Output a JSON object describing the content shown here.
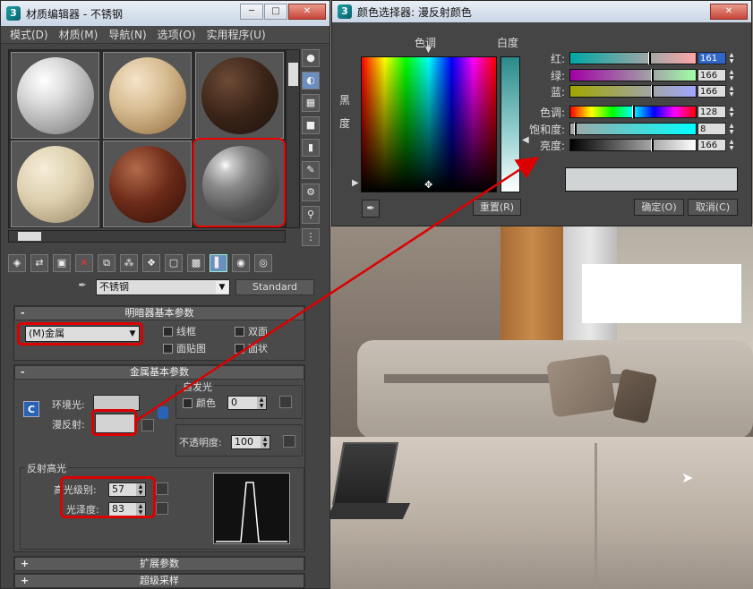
{
  "material_editor": {
    "title": "材质编辑器 - 不锈钢",
    "menu": [
      "模式(D)",
      "材质(M)",
      "导航(N)",
      "选项(O)",
      "实用程序(U)"
    ],
    "material_name": "不锈钢",
    "material_type": "Standard",
    "shader_rollout": {
      "title": "明暗器基本参数",
      "shader": "(M)金属",
      "wire": "线框",
      "two_sided": "双面",
      "face_map": "面贴图",
      "faceted": "面状"
    },
    "metal_rollout": {
      "title": "金属基本参数",
      "ambient_label": "环境光:",
      "diffuse_label": "漫反射:",
      "self_illum_title": "自发光",
      "color_label": "颜色",
      "color_value": "0",
      "opacity_label": "不透明度:",
      "opacity_value": "100",
      "specular_title": "反射高光",
      "spec_level_label": "高光级别:",
      "spec_level_value": "57",
      "gloss_label": "光泽度:",
      "gloss_value": "83",
      "lock_icon_letter": "C"
    },
    "collapsed_rollouts": [
      "扩展参数",
      "超级采样"
    ]
  },
  "color_selector": {
    "title": "颜色选择器: 漫反射颜色",
    "hue_label": "色调",
    "whiteness_label": "白度",
    "blackness_label_1": "黑",
    "blackness_label_2": "度",
    "channels": [
      {
        "label": "红:",
        "value": "161",
        "fraction": 0.63
      },
      {
        "label": "绿:",
        "value": "166",
        "fraction": 0.65
      },
      {
        "label": "蓝:",
        "value": "166",
        "fraction": 0.65
      },
      {
        "label": "色调:",
        "value": "128",
        "fraction": 0.5
      },
      {
        "label": "饱和度:",
        "value": "8",
        "fraction": 0.03
      },
      {
        "label": "亮度:",
        "value": "166",
        "fraction": 0.65
      }
    ],
    "reset": "重置(R)",
    "ok": "确定(O)",
    "cancel": "取消(C)"
  },
  "colors": {
    "highlight_red": "#dd0000",
    "diffuse_swatch": "#d3d3d3",
    "selected_value": "#2f66c8"
  }
}
